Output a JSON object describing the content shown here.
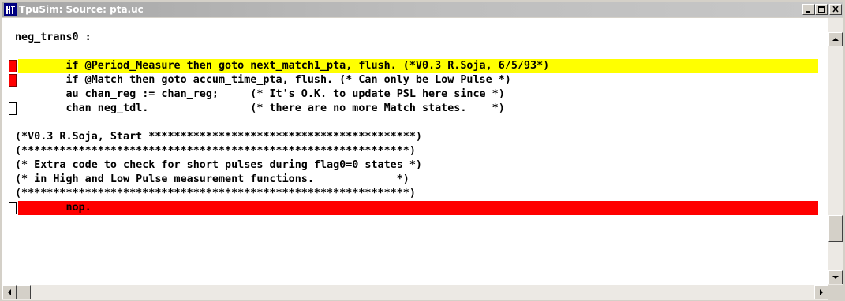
{
  "window": {
    "title": "TpuSim: Source: pta.uc",
    "icon": "tpusim-app-icon",
    "controls": {
      "minimize": "minimize-icon",
      "maximize": "maximize-icon",
      "close": "close-icon"
    }
  },
  "editor": {
    "lines": [
      {
        "text": "neg_trans0 :",
        "highlight": "none",
        "breakpoint": "none"
      },
      {
        "text": "",
        "highlight": "none",
        "breakpoint": "none"
      },
      {
        "text": "        if @Period_Measure then goto next_match1_pta, flush. (*V0.3 R.Soja, 6/5/93*)",
        "highlight": "yellow",
        "breakpoint": "set"
      },
      {
        "text": "        if @Match then goto accum_time_pta, flush. (* Can only be Low Pulse *)",
        "highlight": "none",
        "breakpoint": "set"
      },
      {
        "text": "        au chan_reg := chan_reg;     (* It's O.K. to update PSL here since *)",
        "highlight": "none",
        "breakpoint": "none"
      },
      {
        "text": "        chan neg_tdl.                (* there are no more Match states.    *)",
        "highlight": "none",
        "breakpoint": "empty"
      },
      {
        "text": "",
        "highlight": "none",
        "breakpoint": "none"
      },
      {
        "text": "(*V0.3 R.Soja, Start ******************************************)",
        "highlight": "none",
        "breakpoint": "none"
      },
      {
        "text": "(*************************************************************)",
        "highlight": "none",
        "breakpoint": "none"
      },
      {
        "text": "(* Extra code to check for short pulses during flag0=0 states *)",
        "highlight": "none",
        "breakpoint": "none"
      },
      {
        "text": "(* in High and Low Pulse measurement functions.             *)",
        "highlight": "none",
        "breakpoint": "none"
      },
      {
        "text": "(*************************************************************)",
        "highlight": "none",
        "breakpoint": "none"
      },
      {
        "text": "        nop.",
        "highlight": "red",
        "breakpoint": "empty"
      }
    ],
    "colors": {
      "current_line": "#ffff00",
      "break_line": "#ff0000",
      "breakpoint": "#ff0000"
    }
  },
  "scrollbars": {
    "vertical": {
      "up": "arrow-up-icon",
      "down": "arrow-down-icon"
    },
    "horizontal": {
      "left": "arrow-left-icon",
      "right": "arrow-right-icon"
    }
  }
}
